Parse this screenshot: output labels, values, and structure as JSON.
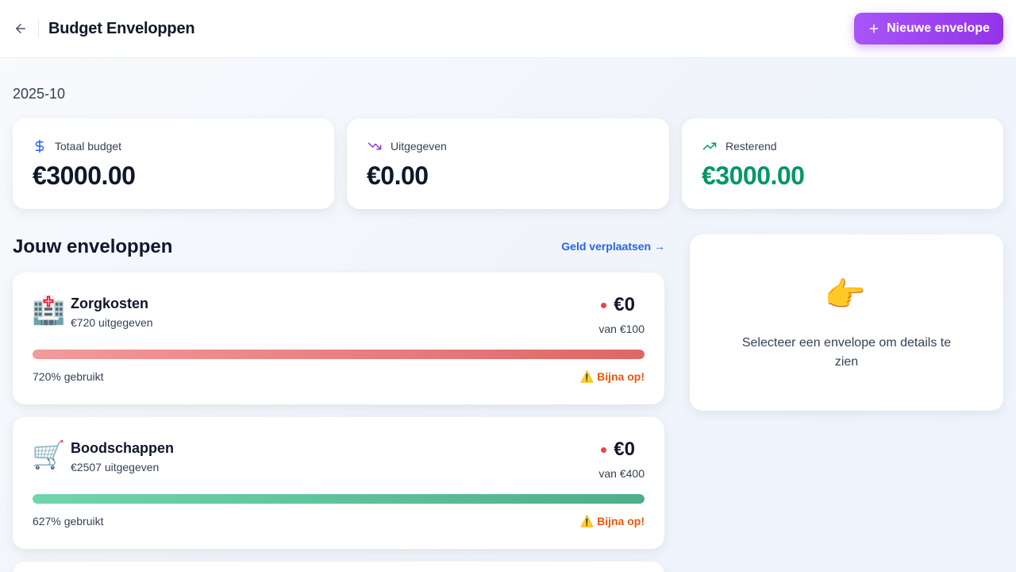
{
  "header": {
    "title": "Budget Enveloppen",
    "new_button_label": "Nieuwe envelope"
  },
  "period": "2025-10",
  "stats": {
    "total": {
      "label": "Totaal budget",
      "value": "€3000.00",
      "icon": "dollar-icon",
      "color": "#2563eb"
    },
    "spent": {
      "label": "Uitgegeven",
      "value": "€0.00",
      "icon": "trending-down-icon",
      "color": "#9333ea"
    },
    "remaining": {
      "label": "Resterend",
      "value": "€3000.00",
      "icon": "trending-up-icon",
      "color": "#059669"
    }
  },
  "envelopes_section": {
    "title": "Jouw enveloppen",
    "move_link": "Geld verplaatsen →"
  },
  "envelopes": [
    {
      "emoji": "🏥",
      "name": "Zorgkosten",
      "spent": "€720 uitgegeven",
      "amount": "€0",
      "of": "van €100",
      "progress": 1.0,
      "bar_color": "#e06666",
      "used": "720% gebruikt",
      "warning": "⚠️ Bijna op!"
    },
    {
      "emoji": "🛒",
      "name": "Boodschappen",
      "spent": "€2507 uitgegeven",
      "amount": "€0",
      "of": "van €400",
      "progress": 1.0,
      "bar_color": "#4caf8a",
      "used": "627% gebruikt",
      "warning": "⚠️ Bijna op!"
    }
  ],
  "detail": {
    "emoji": "👈",
    "text": "Selecteer een envelope om details te zien"
  },
  "colors": {
    "accent": "#9333ea",
    "link": "#2563eb",
    "positive": "#059669",
    "warning": "#ea580c",
    "danger_dot": "#ef4444"
  }
}
